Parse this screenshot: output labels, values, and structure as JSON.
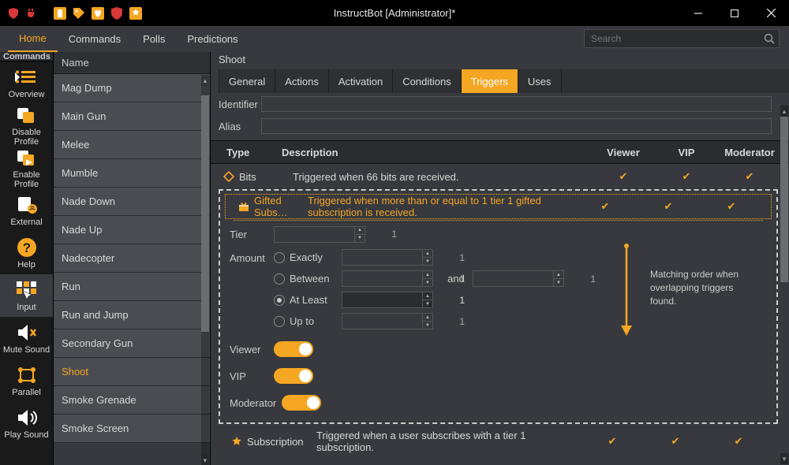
{
  "window": {
    "title": "InstructBot [Administrator]*"
  },
  "tabs": [
    "Home",
    "Commands",
    "Polls",
    "Predictions"
  ],
  "activeTab": 0,
  "search": {
    "placeholder": "Search"
  },
  "sidebar": {
    "header": "Commands",
    "items": [
      {
        "label": "Overview"
      },
      {
        "label": "Disable Profile"
      },
      {
        "label": "Enable Profile"
      },
      {
        "label": "External"
      },
      {
        "label": "Help"
      },
      {
        "label": "Input"
      },
      {
        "label": "Mute Sound"
      },
      {
        "label": "Parallel"
      },
      {
        "label": "Play Sound"
      }
    ],
    "activeIndex": 5
  },
  "nameCol": {
    "header": "Name",
    "items": [
      "Mag Dump",
      "Main Gun",
      "Melee",
      "Mumble",
      "Nade Down",
      "Nade Up",
      "Nadecopter",
      "Run",
      "Run and Jump",
      "Secondary Gun",
      "Shoot",
      "Smoke Grenade",
      "Smoke Screen"
    ],
    "activeIndex": 10
  },
  "main": {
    "title": "Shoot",
    "subTabs": [
      "General",
      "Actions",
      "Activation",
      "Conditions",
      "Triggers",
      "Uses"
    ],
    "activeSubTab": 4,
    "fields": {
      "identifier": "Identifier",
      "alias": "Alias"
    },
    "tableHead": {
      "type": "Type",
      "desc": "Description",
      "viewer": "Viewer",
      "vip": "VIP",
      "mod": "Moderator"
    },
    "rows": {
      "bits": {
        "type": "Bits",
        "desc": "Triggered when 66 bits are received."
      },
      "gifted": {
        "type": "Gifted Subs…",
        "desc": "Triggered when more than or equal to 1 tier 1 gifted subscription is received."
      },
      "sub": {
        "type": "Subscription",
        "desc": "Triggered when a user subscribes with a tier 1 subscription."
      }
    },
    "editor": {
      "tierLabel": "Tier",
      "tierValue": "1",
      "amountLabel": "Amount",
      "opts": {
        "exactly": "Exactly",
        "between": "Between",
        "atleast": "At Least",
        "upto": "Up to",
        "and": "and"
      },
      "selected": "atleast",
      "exactlyVal": "1",
      "betweenA": "1",
      "betweenB": "1",
      "atleastVal": "1",
      "uptoVal": "1",
      "viewerLabel": "Viewer",
      "vipLabel": "VIP",
      "modLabel": "Moderator",
      "note": "Matching order when overlapping triggers found."
    }
  }
}
